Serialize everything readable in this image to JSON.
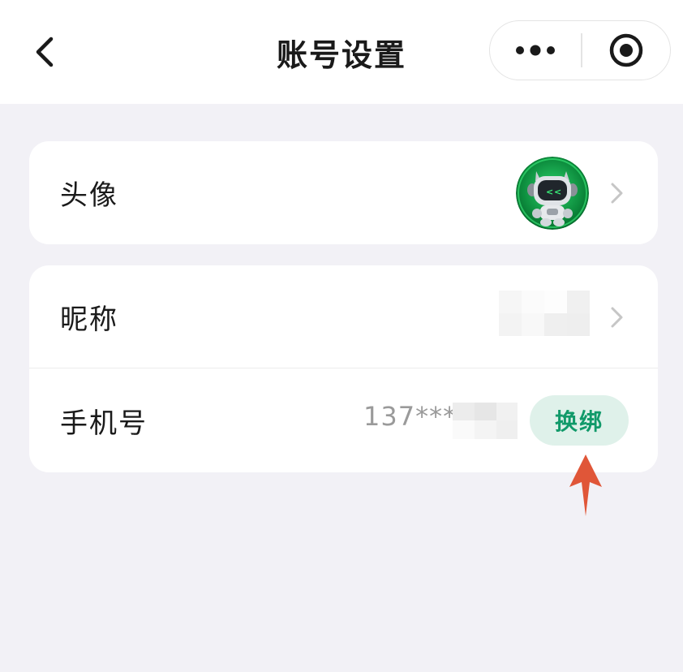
{
  "header": {
    "title": "账号设置",
    "back_icon": "chevron-left-icon",
    "more_icon": "more-dots-icon",
    "close_icon": "record-circle-icon"
  },
  "account": {
    "avatar": {
      "label": "头像",
      "icon": "robot-avatar"
    },
    "nickname": {
      "label": "昵称",
      "value": ""
    },
    "phone": {
      "label": "手机号",
      "value": "137****",
      "button_label": "换绑",
      "button_text_color": "#119a6a",
      "button_bg_color": "#dff1ea"
    }
  },
  "annotation": {
    "arrow_color": "#e05638",
    "icon": "arrow-up-icon"
  }
}
